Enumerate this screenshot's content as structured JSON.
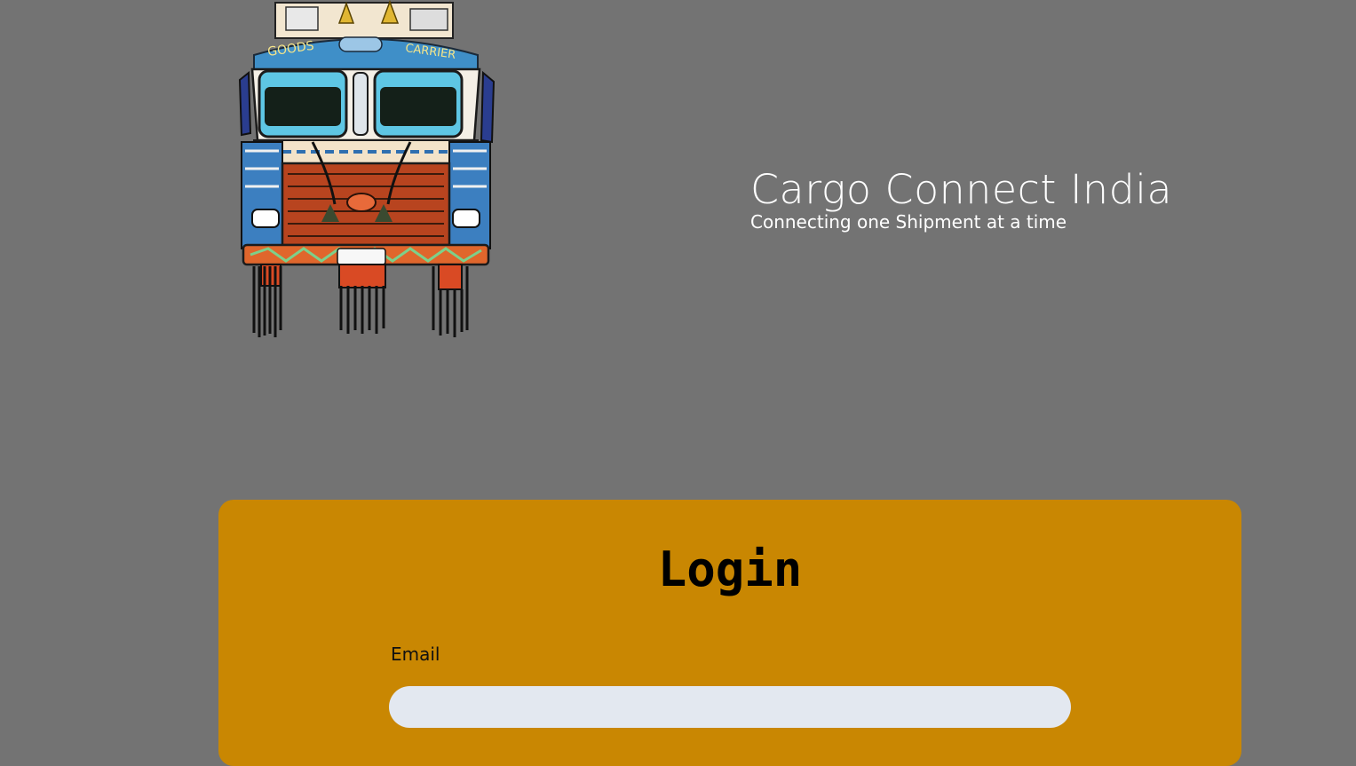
{
  "brand": {
    "title": "Cargo Connect India",
    "subtitle": "Connecting one Shipment at a time",
    "logo_text_left": "GOODS",
    "logo_text_right": "CARRIER"
  },
  "login": {
    "title": "Login",
    "email_label": "Email",
    "email_value": "",
    "email_placeholder": ""
  },
  "colors": {
    "background": "#737373",
    "card": "#c98702",
    "input": "#e3e8f0",
    "brand_text": "#ffffff"
  },
  "icons": {
    "truck": "decorated-indian-truck-illustration"
  }
}
